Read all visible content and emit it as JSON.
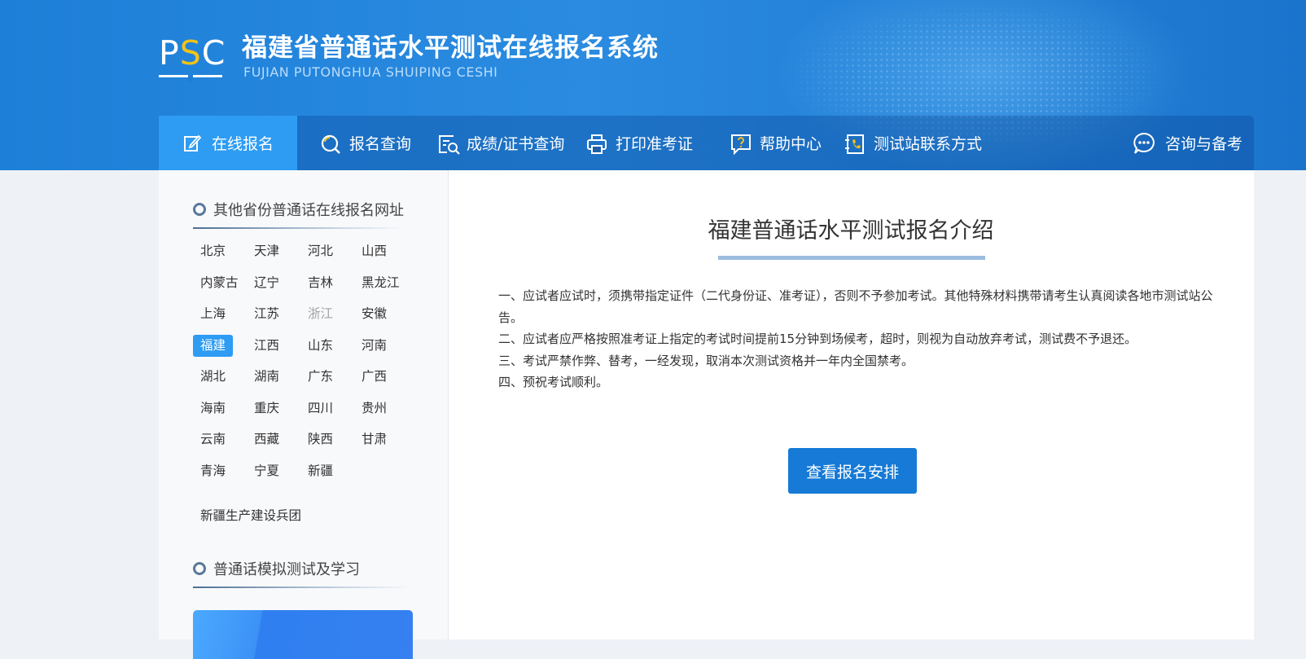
{
  "header": {
    "logo": {
      "p": "P",
      "s": "S",
      "c": "C"
    },
    "title": "福建省普通话水平测试在线报名系统",
    "subtitle": "FUJIAN PUTONGHUA SHUIPING CESHI"
  },
  "nav": {
    "items": [
      {
        "label": "在线报名",
        "icon": "edit-icon",
        "active": true
      },
      {
        "label": "报名查询",
        "icon": "search-icon"
      },
      {
        "label": "成绩/证书查询",
        "icon": "certificate-search-icon"
      },
      {
        "label": "打印准考证",
        "icon": "printer-icon"
      },
      {
        "label": "帮助中心",
        "icon": "help-icon"
      },
      {
        "label": "测试站联系方式",
        "icon": "phone-book-icon"
      },
      {
        "label": "咨询与备考",
        "icon": "chat-icon"
      }
    ]
  },
  "sidebar": {
    "provinces_heading": "其他省份普通话在线报名网址",
    "provinces": [
      "北京",
      "天津",
      "河北",
      "山西",
      "内蒙古",
      "辽宁",
      "吉林",
      "黑龙江",
      "上海",
      "江苏",
      "浙江",
      "安徽",
      "福建",
      "江西",
      "山东",
      "河南",
      "湖北",
      "湖南",
      "广东",
      "广西",
      "海南",
      "重庆",
      "四川",
      "贵州",
      "云南",
      "西藏",
      "陕西",
      "甘肃",
      "青海",
      "宁夏",
      "新疆"
    ],
    "selected_province": "福建",
    "disabled_province": "浙江",
    "extra": "新疆生产建设兵团",
    "study_heading": "普通话模拟测试及学习"
  },
  "content": {
    "title": "福建普通话水平测试报名介绍",
    "notices": [
      "一、应试者应试时，须携带指定证件（二代身份证、准考证），否则不予参加考试。其他特殊材料携带请考生认真阅读各地市测试站公告。",
      "二、应试者应严格按照准考证上指定的考试时间提前15分钟到场候考，超时，则视为自动放弃考试，测试费不予退还。",
      "三、考试严禁作弊、替考，一经发现，取消本次测试资格并一年内全国禁考。",
      "四、预祝考试顺利。"
    ],
    "button_label": "查看报名安排"
  },
  "colors": {
    "header_blue": "#1e7fd8",
    "active_nav": "#2e9cf3",
    "button": "#167ad6",
    "logo_s": "#f5c218"
  }
}
